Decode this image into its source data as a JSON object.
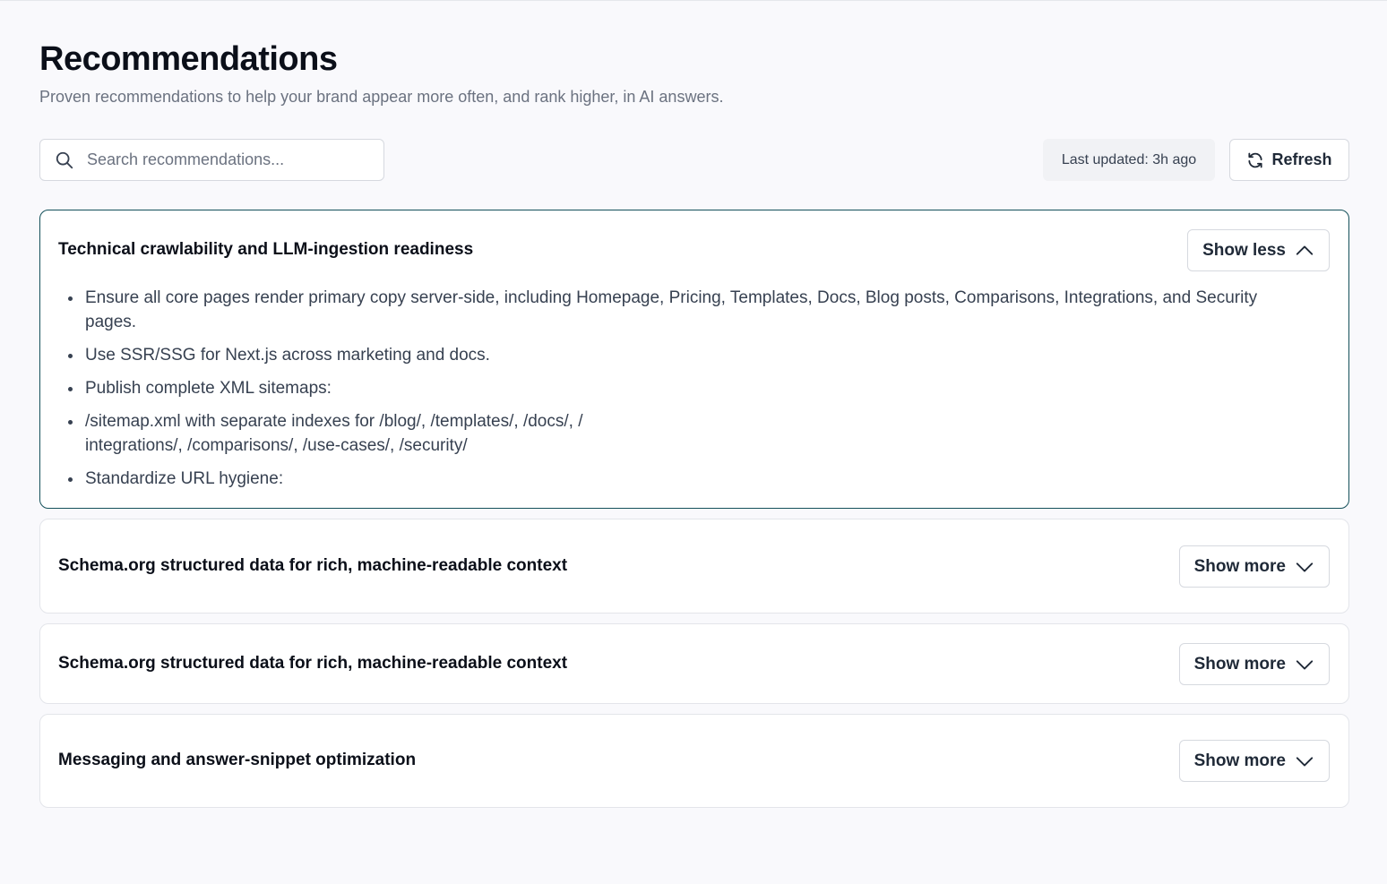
{
  "header": {
    "title": "Recommendations",
    "subtitle": "Proven recommendations to help your brand appear more often, and rank higher, in AI answers."
  },
  "search": {
    "placeholder": "Search recommendations...",
    "value": "",
    "icon": "search-icon"
  },
  "toolbar": {
    "last_updated": "Last updated: 3h ago",
    "refresh_label": "Refresh",
    "refresh_icon": "refresh-icon"
  },
  "cards": [
    {
      "title": "Technical crawlability and LLM-ingestion readiness",
      "expanded": true,
      "toggle_label": "Show less",
      "toggle_icon": "chevron-up-icon",
      "items": [
        "Ensure all core pages render primary copy server-side, including Homepage, Pricing, Templates, Docs, Blog posts, Comparisons, Integrations, and Security pages.",
        "Use SSR/SSG for Next.js across marketing and docs.",
        "Publish complete XML sitemaps:",
        "/sitemap.xml with separate indexes for /blog/, /templates/, /docs/, /",
        "integrations/, /comparisons/, /use-cases/, /security/",
        "Standardize URL hygiene:"
      ]
    },
    {
      "title": "Schema.org structured data for rich, machine-readable context",
      "expanded": false,
      "toggle_label": "Show more",
      "toggle_icon": "chevron-down-icon"
    },
    {
      "title": "Schema.org structured data for rich, machine-readable context",
      "expanded": false,
      "toggle_label": "Show more",
      "toggle_icon": "chevron-down-icon"
    },
    {
      "title": "Messaging and answer-snippet optimization",
      "expanded": false,
      "toggle_label": "Show more",
      "toggle_icon": "chevron-down-icon"
    }
  ]
}
